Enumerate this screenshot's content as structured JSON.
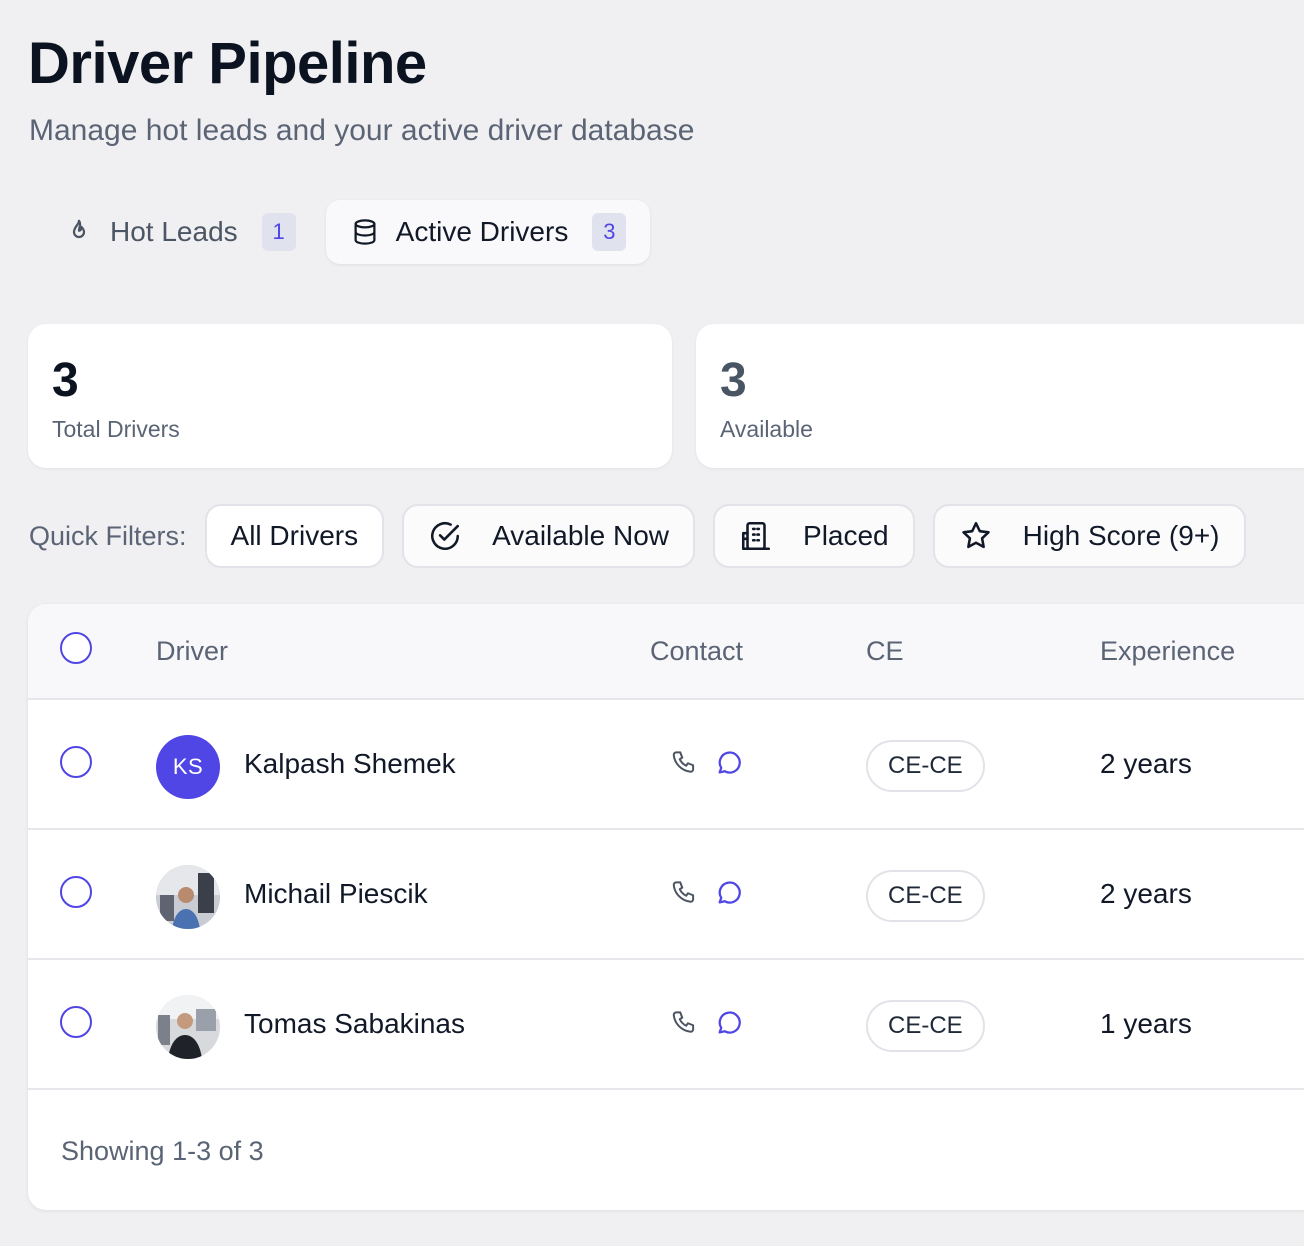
{
  "header": {
    "title": "Driver Pipeline",
    "subtitle": "Manage hot leads and your active driver database"
  },
  "tabs": [
    {
      "label": "Hot Leads",
      "count": "1",
      "icon": "flame-icon",
      "active": false
    },
    {
      "label": "Active Drivers",
      "count": "3",
      "icon": "database-icon",
      "active": true
    }
  ],
  "stats": [
    {
      "value": "3",
      "label": "Total Drivers"
    },
    {
      "value": "3",
      "label": "Available"
    }
  ],
  "filters": {
    "label": "Quick Filters:",
    "chips": [
      {
        "label": "All Drivers",
        "icon": null
      },
      {
        "label": "Available Now",
        "icon": "check-circle-icon"
      },
      {
        "label": "Placed",
        "icon": "building-icon"
      },
      {
        "label": "High Score (9+)",
        "icon": "star-icon"
      }
    ]
  },
  "table": {
    "columns": [
      "Driver",
      "Contact",
      "CE",
      "Experience"
    ],
    "rows": [
      {
        "name": "Kalpash Shemek",
        "initials": "KS",
        "ce": "CE-CE",
        "experience": "2 years"
      },
      {
        "name": "Michail Piescik",
        "initials": "",
        "ce": "CE-CE",
        "experience": "2 years"
      },
      {
        "name": "Tomas Sabakinas",
        "initials": "",
        "ce": "CE-CE",
        "experience": "1 years"
      }
    ],
    "footer": "Showing 1-3 of 3"
  },
  "colors": {
    "accent": "#4f46e5",
    "background": "#f0f0f3",
    "muted_text": "#5b6475"
  }
}
